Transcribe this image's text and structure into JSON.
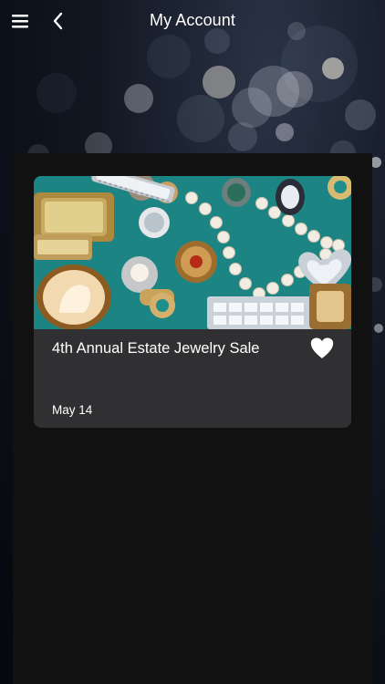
{
  "header": {
    "title": "My Account",
    "menu_icon": "hamburger-menu-icon",
    "back_icon": "chevron-left-icon"
  },
  "event_card": {
    "title": "4th Annual Estate Jewelry Sale",
    "date": "May 14",
    "image": "estate-jewelry-photo",
    "favorite_icon": "heart-icon",
    "favorited": true
  },
  "colors": {
    "card_background": "#303033",
    "panel_background": "#111112",
    "image_background": "#1f8d8a",
    "text": "#ffffff"
  }
}
